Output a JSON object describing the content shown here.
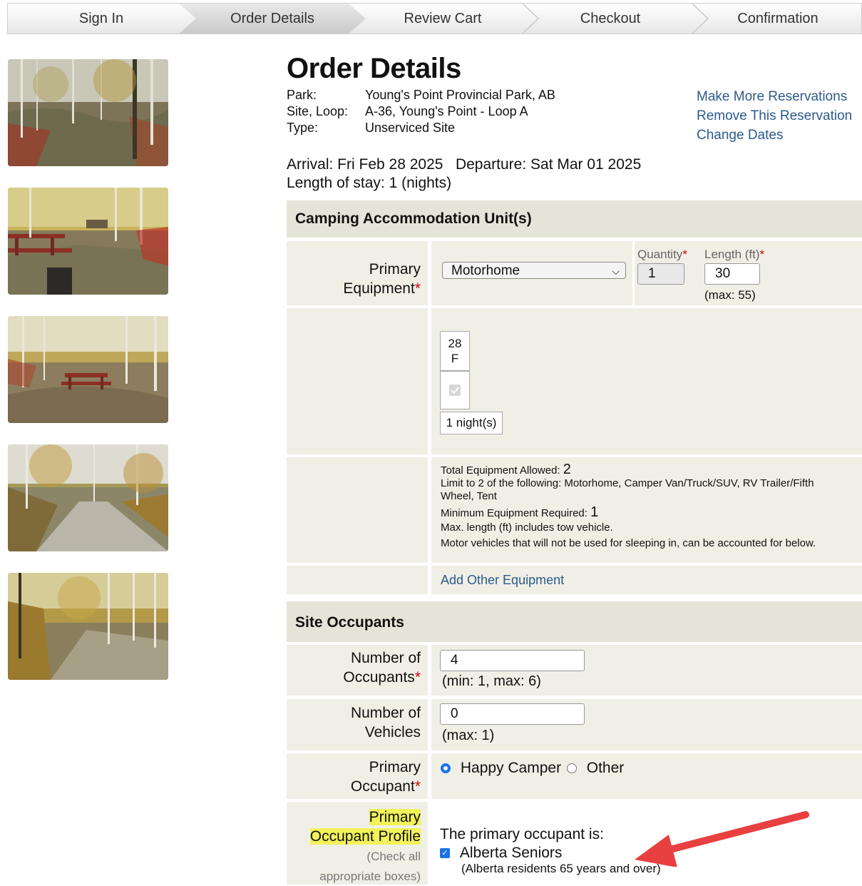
{
  "steps": [
    "Sign In",
    "Order Details",
    "Review Cart",
    "Checkout",
    "Confirmation"
  ],
  "page_title": "Order Details",
  "reservation": {
    "park_label": "Park:",
    "park_value": "Young's Point Provincial Park, AB",
    "site_label": "Site, Loop:",
    "site_value": "A-36, Young's Point - Loop A",
    "type_label": "Type:",
    "type_value": "Unserviced Site"
  },
  "links": {
    "make_more": "Make More Reservations",
    "remove": "Remove This Reservation",
    "change_dates": "Change Dates"
  },
  "dates": {
    "arrival": "Arrival: Fri Feb 28 2025",
    "departure": "Departure: Sat Mar 01 2025",
    "length": "Length of stay: 1 (nights)"
  },
  "equipment_section": {
    "title": "Camping Accommodation Unit(s)",
    "primary_label_1": "Primary",
    "primary_label_2": "Equipment",
    "selected_equipment": "Motorhome",
    "quantity_label": "Quantity",
    "quantity_value": "1",
    "length_label": "Length (ft)",
    "length_value": "30",
    "length_max": "(max: 55)",
    "calendar_day": "28",
    "calendar_weekday": "F",
    "nights_label": "1 night(s)",
    "total_allowed_label": "Total Equipment Allowed:",
    "total_allowed_value": "2",
    "limit_text": "Limit to 2 of the following: Motorhome, Camper Van/Truck/SUV, RV Trailer/Fifth Wheel, Tent",
    "min_required_label": "Minimum Equipment Required:",
    "min_required_value": "1",
    "max_length_note": "Max. length (ft) includes tow vehicle.",
    "motor_note": "Motor vehicles that will not be used for sleeping in, can be accounted for below.",
    "add_other": "Add Other Equipment"
  },
  "occupants_section": {
    "title": "Site Occupants",
    "occupants_label_1": "Number of",
    "occupants_label_2": "Occupants",
    "occupants_value": "4",
    "occupants_range": "(min: 1, max: 6)",
    "vehicles_label_1": "Number of",
    "vehicles_label_2": "Vehicles",
    "vehicles_value": "0",
    "vehicles_range": "(max: 1)",
    "primary_label_1": "Primary",
    "primary_label_2": "Occupant",
    "option_happy": "Happy Camper",
    "option_other": "Other",
    "profile_label_1": "Primary",
    "profile_label_2": "Occupant Profile",
    "profile_hint_1": "(Check all",
    "profile_hint_2": "appropriate boxes)",
    "profile_intro": "The primary occupant is:",
    "profile_option": "Alberta Seniors",
    "profile_option_note": "(Alberta residents 65 years and over)"
  },
  "colors": {
    "link": "#2d5a8c",
    "section_bg": "#e5e4d8",
    "row_bg": "#f0efe6",
    "required": "#d00000",
    "highlight": "#f2f25a",
    "arrow": "#e84040"
  }
}
